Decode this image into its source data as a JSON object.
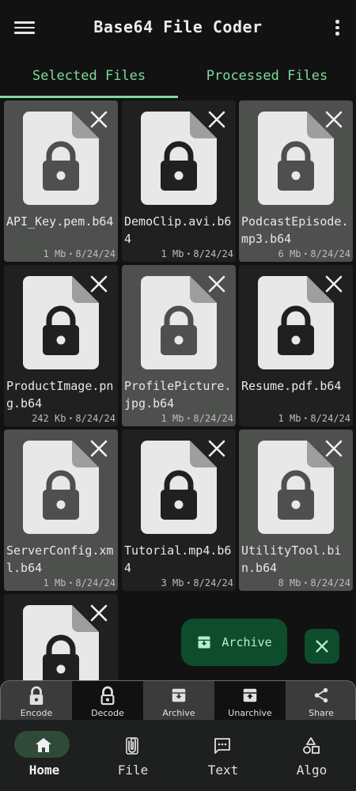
{
  "app": {
    "title": "Base64 File Coder"
  },
  "tabs": [
    {
      "label": "Selected Files"
    },
    {
      "label": "Processed Files"
    }
  ],
  "files": [
    {
      "name": "API_Key.pem.b64",
      "meta": "1 Mb・8/24/24",
      "selected": true
    },
    {
      "name": "DemoClip.avi.b64",
      "meta": "1 Mb・8/24/24",
      "selected": false
    },
    {
      "name": "PodcastEpisode.mp3.b64",
      "meta": "6 Mb・8/24/24",
      "selected": true
    },
    {
      "name": "ProductImage.png.b64",
      "meta": "242 Kb・8/24/24",
      "selected": false
    },
    {
      "name": "ProfilePicture.jpg.b64",
      "meta": "1 Mb・8/24/24",
      "selected": true
    },
    {
      "name": "Resume.pdf.b64",
      "meta": "1 Mb・8/24/24",
      "selected": false
    },
    {
      "name": "ServerConfig.xml.b64",
      "meta": "1 Mb・8/24/24",
      "selected": true
    },
    {
      "name": "Tutorial.mp4.b64",
      "meta": "3 Mb・8/24/24",
      "selected": false
    },
    {
      "name": "UtilityTool.bin.b64",
      "meta": "8 Mb・8/24/24",
      "selected": true
    },
    {
      "name": "",
      "meta": "",
      "selected": false
    }
  ],
  "fab": {
    "archive_label": "Archive"
  },
  "actions": [
    {
      "label": "Encode",
      "icon": "lock-icon"
    },
    {
      "label": "Decode",
      "icon": "lock-outline-icon"
    },
    {
      "label": "Archive",
      "icon": "archive-icon"
    },
    {
      "label": "Unarchive",
      "icon": "unarchive-icon"
    },
    {
      "label": "Share",
      "icon": "share-icon"
    }
  ],
  "nav": [
    {
      "label": "Home",
      "icon": "home-icon",
      "active": true
    },
    {
      "label": "File",
      "icon": "attachment-file-icon",
      "active": false
    },
    {
      "label": "Text",
      "icon": "message-icon",
      "active": false
    },
    {
      "label": "Algo",
      "icon": "shapes-icon",
      "active": false
    }
  ],
  "colors": {
    "accent": "#7ddc9b",
    "selected_tile": "#4d504d",
    "fab": "#0e4d2c"
  }
}
